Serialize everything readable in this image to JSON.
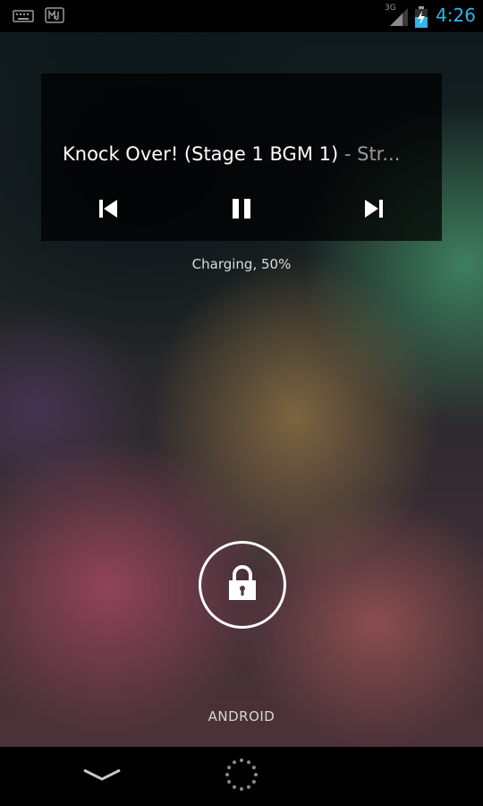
{
  "status_bar": {
    "notification_icons": [
      "keyboard-icon",
      "music-app-icon"
    ],
    "network_label": "3G",
    "time": "4:26",
    "accent_color": "#33b5e5"
  },
  "music_widget": {
    "track_title": "Knock Over! (Stage 1 BGM 1)",
    "separator": " - ",
    "artist_truncated": "Str...",
    "controls": [
      "previous-icon",
      "pause-icon",
      "next-icon"
    ]
  },
  "lockscreen": {
    "charging_status": "Charging, 50%",
    "carrier": "ANDROID",
    "unlock_icon": "padlock-icon"
  },
  "nav_bar": {
    "buttons": [
      "chevron-down-icon",
      "loading-spinner-icon"
    ]
  }
}
